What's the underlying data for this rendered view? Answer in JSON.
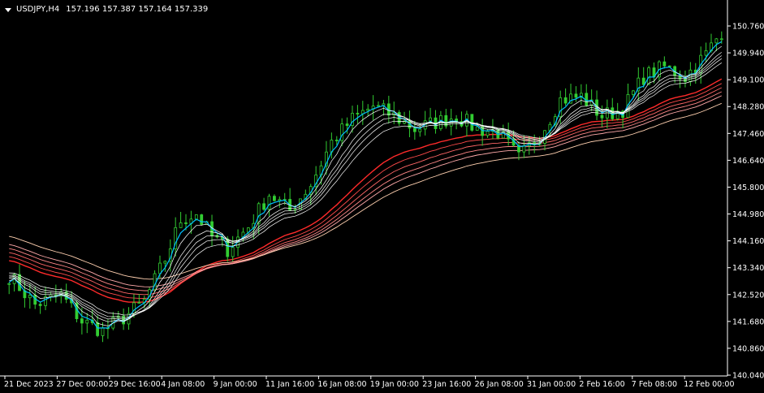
{
  "header": {
    "symbol": "USDJPY,H4",
    "ohlc": "157.196 157.387 157.164 157.339"
  },
  "colors": {
    "background": "#000000",
    "axis": "#ffffff",
    "candle": "#32cd32",
    "fast_ma_group": [
      "#00bfff",
      "#ffffff",
      "#ffffff",
      "#ffffff",
      "#ffffff",
      "#ffffff"
    ],
    "slow_ma_group": [
      "#ff2a2a",
      "#ff4a4a",
      "#ff6666",
      "#ff8888",
      "#ffaaaa",
      "#ffd0b0"
    ]
  },
  "chart_data": {
    "type": "line",
    "title": "",
    "price_axis": {
      "ticks": [
        "150.760",
        "149.940",
        "149.100",
        "148.280",
        "147.460",
        "146.640",
        "145.800",
        "144.980",
        "144.160",
        "143.340",
        "142.520",
        "141.680",
        "140.860",
        "140.040"
      ],
      "ylim": [
        140.04,
        150.76
      ]
    },
    "time_axis": {
      "ticks": [
        "21 Dec 2023",
        "27 Dec 00:00",
        "29 Dec 16:00",
        "4 Jan 08:00",
        "9 Jan 00:00",
        "11 Jan 16:00",
        "16 Jan 08:00",
        "19 Jan 00:00",
        "23 Jan 16:00",
        "26 Jan 08:00",
        "31 Jan 00:00",
        "2 Feb 16:00",
        "7 Feb 08:00",
        "12 Feb 00:00"
      ]
    },
    "price_path": [
      [
        0,
        143.1
      ],
      [
        5,
        142.2
      ],
      [
        10,
        142.5
      ],
      [
        14,
        141.7
      ],
      [
        18,
        141.4
      ],
      [
        22,
        141.8
      ],
      [
        26,
        142.3
      ],
      [
        30,
        143.6
      ],
      [
        33,
        144.8
      ],
      [
        36,
        145.0
      ],
      [
        39,
        144.3
      ],
      [
        42,
        143.9
      ],
      [
        46,
        144.6
      ],
      [
        50,
        145.6
      ],
      [
        54,
        145.1
      ],
      [
        58,
        145.9
      ],
      [
        62,
        147.2
      ],
      [
        66,
        147.9
      ],
      [
        70,
        148.3
      ],
      [
        74,
        148.0
      ],
      [
        78,
        147.6
      ],
      [
        82,
        147.8
      ],
      [
        86,
        148.0
      ],
      [
        90,
        147.6
      ],
      [
        94,
        147.5
      ],
      [
        98,
        146.7
      ],
      [
        102,
        147.4
      ],
      [
        106,
        148.5
      ],
      [
        110,
        148.6
      ],
      [
        114,
        148.0
      ],
      [
        118,
        148.2
      ],
      [
        122,
        149.2
      ],
      [
        126,
        149.5
      ],
      [
        130,
        149.2
      ],
      [
        134,
        149.9
      ],
      [
        137,
        150.6
      ]
    ],
    "fast_ma_periods": [
      3,
      5,
      8,
      10,
      12,
      15
    ],
    "slow_ma_periods": [
      30,
      35,
      40,
      45,
      50,
      60
    ],
    "grid": false
  }
}
